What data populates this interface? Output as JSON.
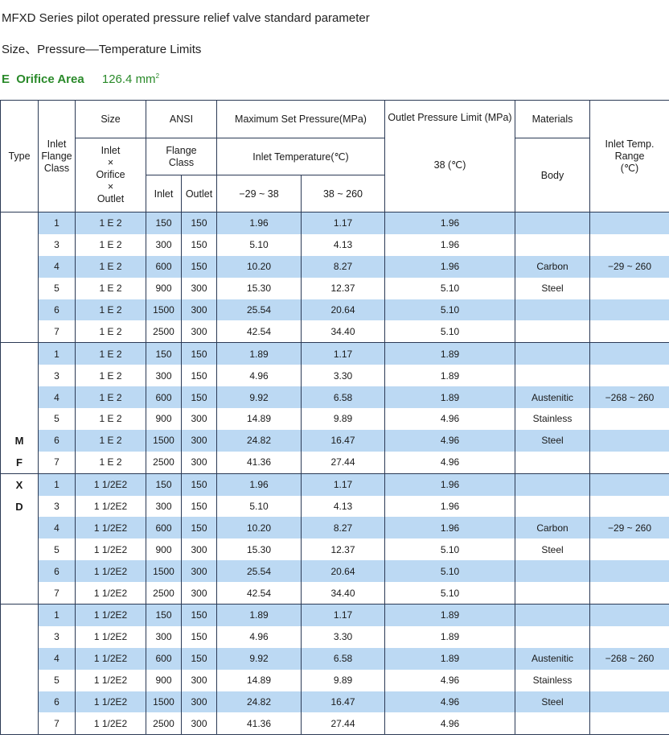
{
  "title": "MFXD Series pilot operated pressure relief valve standard parameter",
  "subtitle": "Size、Pressure––Temperature Limits",
  "orifice": {
    "model": "E",
    "label": "Orifice Area",
    "value": "126.4 mm",
    "unit_sup": "2"
  },
  "headers": {
    "type": "Type",
    "inlet_flange_class": [
      "Inlet",
      "Flange",
      "Class"
    ],
    "size": "Size",
    "size_detail": [
      "Inlet",
      "×",
      "Orifice",
      "×",
      "Outlet"
    ],
    "ansi": "ANSI",
    "flange_class": [
      "Flange",
      "Class"
    ],
    "inlet": "Inlet",
    "outlet": "Outlet",
    "max_set_pressure": "Maximum Set Pressure(MPa)",
    "inlet_temperature": "Inlet Temperature(℃)",
    "temp_low": "−29 ~ 38",
    "temp_high": "38 ~ 260",
    "outlet_pressure_limit": "Outlet Pressure Limit (MPa)",
    "outlet_temp": "38 (℃)",
    "materials": "Materials",
    "body": "Body",
    "inlet_temp_range": [
      "Inlet Temp.",
      "Range",
      "(℃)"
    ]
  },
  "type_letters": [
    "M",
    "F",
    "X",
    "D"
  ],
  "rows": [
    [
      "1",
      "1 E 2",
      "150",
      "150",
      "1.96",
      "1.17",
      "1.96",
      "",
      ""
    ],
    [
      "3",
      "1 E 2",
      "300",
      "150",
      "5.10",
      "4.13",
      "1.96",
      "",
      ""
    ],
    [
      "4",
      "1 E 2",
      "600",
      "150",
      "10.20",
      "8.27",
      "1.96",
      "Carbon",
      "−29 ~ 260"
    ],
    [
      "5",
      "1 E 2",
      "900",
      "300",
      "15.30",
      "12.37",
      "5.10",
      "Steel",
      ""
    ],
    [
      "6",
      "1 E 2",
      "1500",
      "300",
      "25.54",
      "20.64",
      "5.10",
      "",
      ""
    ],
    [
      "7",
      "1 E 2",
      "2500",
      "300",
      "42.54",
      "34.40",
      "5.10",
      "",
      ""
    ],
    [
      "1",
      "1 E 2",
      "150",
      "150",
      "1.89",
      "1.17",
      "1.89",
      "",
      ""
    ],
    [
      "3",
      "1 E 2",
      "300",
      "150",
      "4.96",
      "3.30",
      "1.89",
      "",
      ""
    ],
    [
      "4",
      "1 E 2",
      "600",
      "150",
      "9.92",
      "6.58",
      "1.89",
      "Austenitic",
      "−268 ~ 260"
    ],
    [
      "5",
      "1 E 2",
      "900",
      "300",
      "14.89",
      "9.89",
      "4.96",
      "Stainless",
      ""
    ],
    [
      "6",
      "1 E 2",
      "1500",
      "300",
      "24.82",
      "16.47",
      "4.96",
      "Steel",
      ""
    ],
    [
      "7",
      "1 E 2",
      "2500",
      "300",
      "41.36",
      "27.44",
      "4.96",
      "",
      ""
    ],
    [
      "1",
      "1 1/2E2",
      "150",
      "150",
      "1.96",
      "1.17",
      "1.96",
      "",
      ""
    ],
    [
      "3",
      "1 1/2E2",
      "300",
      "150",
      "5.10",
      "4.13",
      "1.96",
      "",
      ""
    ],
    [
      "4",
      "1 1/2E2",
      "600",
      "150",
      "10.20",
      "8.27",
      "1.96",
      "Carbon",
      "−29 ~ 260"
    ],
    [
      "5",
      "1 1/2E2",
      "900",
      "300",
      "15.30",
      "12.37",
      "5.10",
      "Steel",
      ""
    ],
    [
      "6",
      "1 1/2E2",
      "1500",
      "300",
      "25.54",
      "20.64",
      "5.10",
      "",
      ""
    ],
    [
      "7",
      "1 1/2E2",
      "2500",
      "300",
      "42.54",
      "34.40",
      "5.10",
      "",
      ""
    ],
    [
      "1",
      "1 1/2E2",
      "150",
      "150",
      "1.89",
      "1.17",
      "1.89",
      "",
      ""
    ],
    [
      "3",
      "1 1/2E2",
      "300",
      "150",
      "4.96",
      "3.30",
      "1.89",
      "",
      ""
    ],
    [
      "4",
      "1 1/2E2",
      "600",
      "150",
      "9.92",
      "6.58",
      "1.89",
      "Austenitic",
      "−268 ~ 260"
    ],
    [
      "5",
      "1 1/2E2",
      "900",
      "300",
      "14.89",
      "9.89",
      "4.96",
      "Stainless",
      ""
    ],
    [
      "6",
      "1 1/2E2",
      "1500",
      "300",
      "24.82",
      "16.47",
      "4.96",
      "Steel",
      ""
    ],
    [
      "7",
      "1 1/2E2",
      "2500",
      "300",
      "41.36",
      "27.44",
      "4.96",
      "",
      ""
    ]
  ],
  "colors": {
    "band": "#bcd9f3",
    "orifice_green": "#2a8a2a",
    "border": "#2b3a55"
  }
}
